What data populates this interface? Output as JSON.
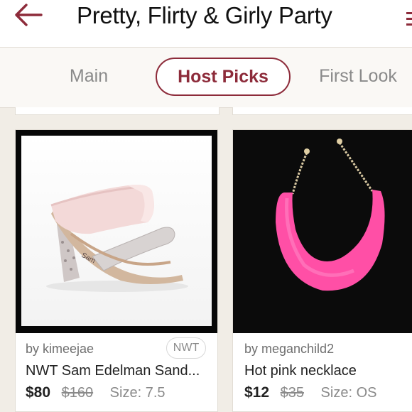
{
  "header": {
    "title": "Pretty, Flirty & Girly Party",
    "accent_color": "#8d2b3a",
    "back_icon": "arrow-left-icon",
    "menu_icon": "menu-icon"
  },
  "tabs": [
    {
      "label": "Main",
      "selected": false
    },
    {
      "label": "Host Picks",
      "selected": true
    },
    {
      "label": "First Look",
      "selected": false
    }
  ],
  "listings": [
    {
      "seller": "by kimeejae",
      "badge": "NWT",
      "title": "NWT Sam Edelman Sand...",
      "price": "$80",
      "original_price": "$160",
      "size": "Size: 7.5"
    },
    {
      "seller": "by meganchild2",
      "title": "Hot pink necklace",
      "price": "$12",
      "original_price": "$35",
      "size": "Size: OS"
    }
  ]
}
